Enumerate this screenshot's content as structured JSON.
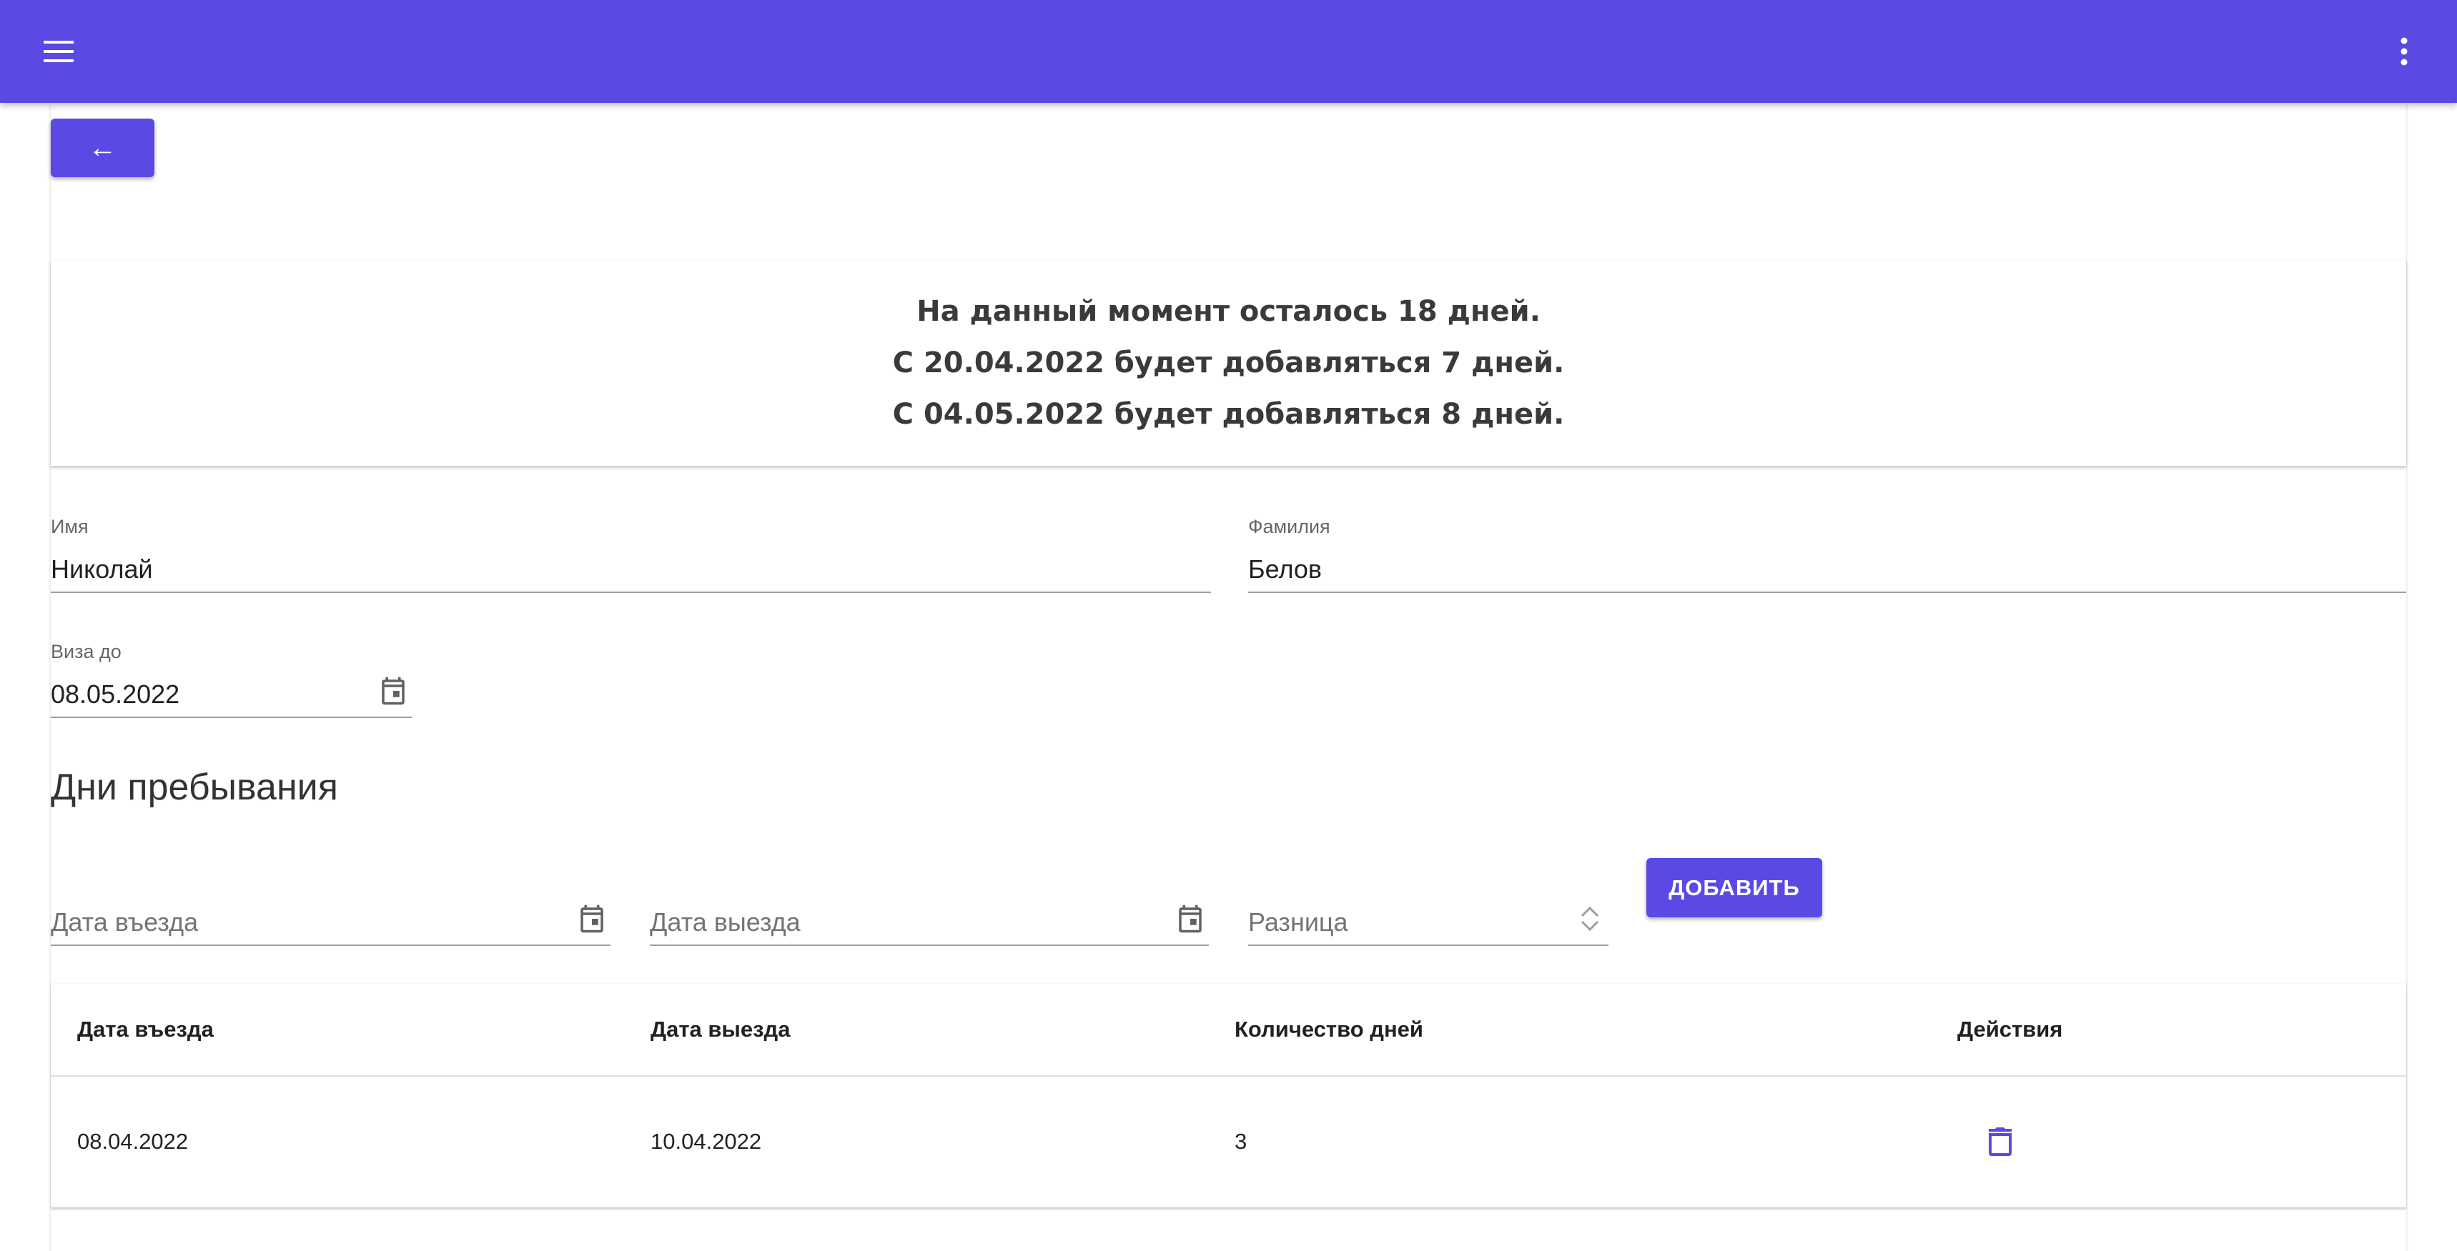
{
  "appbar": {
    "menu_icon": "menu-icon",
    "more_icon": "more-vert-icon",
    "color": "#5a4ae3"
  },
  "back_button": {
    "label": "←"
  },
  "info": {
    "lines": [
      "На данный момент осталось 18 дней.",
      "С 20.04.2022 будет добавляться 7 дней.",
      "С 04.05.2022 будет добавляться 8 дней."
    ]
  },
  "form": {
    "first_name": {
      "label": "Имя",
      "value": "Николай"
    },
    "last_name": {
      "label": "Фамилия",
      "value": "Белов"
    },
    "visa_until": {
      "label": "Виза до",
      "value": "08.05.2022",
      "icon": "calendar-icon"
    }
  },
  "stay": {
    "title": "Дни пребывания",
    "entry_date": {
      "placeholder": "Дата въезда",
      "icon": "calendar-icon"
    },
    "exit_date": {
      "placeholder": "Дата выезда",
      "icon": "calendar-icon"
    },
    "difference": {
      "placeholder": "Разница",
      "icon": "stepper-icon"
    },
    "add_label": "ДОБАВИТЬ"
  },
  "table": {
    "columns": [
      "Дата въезда",
      "Дата выезда",
      "Количество дней",
      "Действия"
    ],
    "rows": [
      {
        "entry": "08.04.2022",
        "exit": "10.04.2022",
        "days": "3",
        "action_icon": "trash-icon"
      }
    ]
  },
  "colors": {
    "primary": "#5a4ae3",
    "icon_gray": "#616161"
  }
}
